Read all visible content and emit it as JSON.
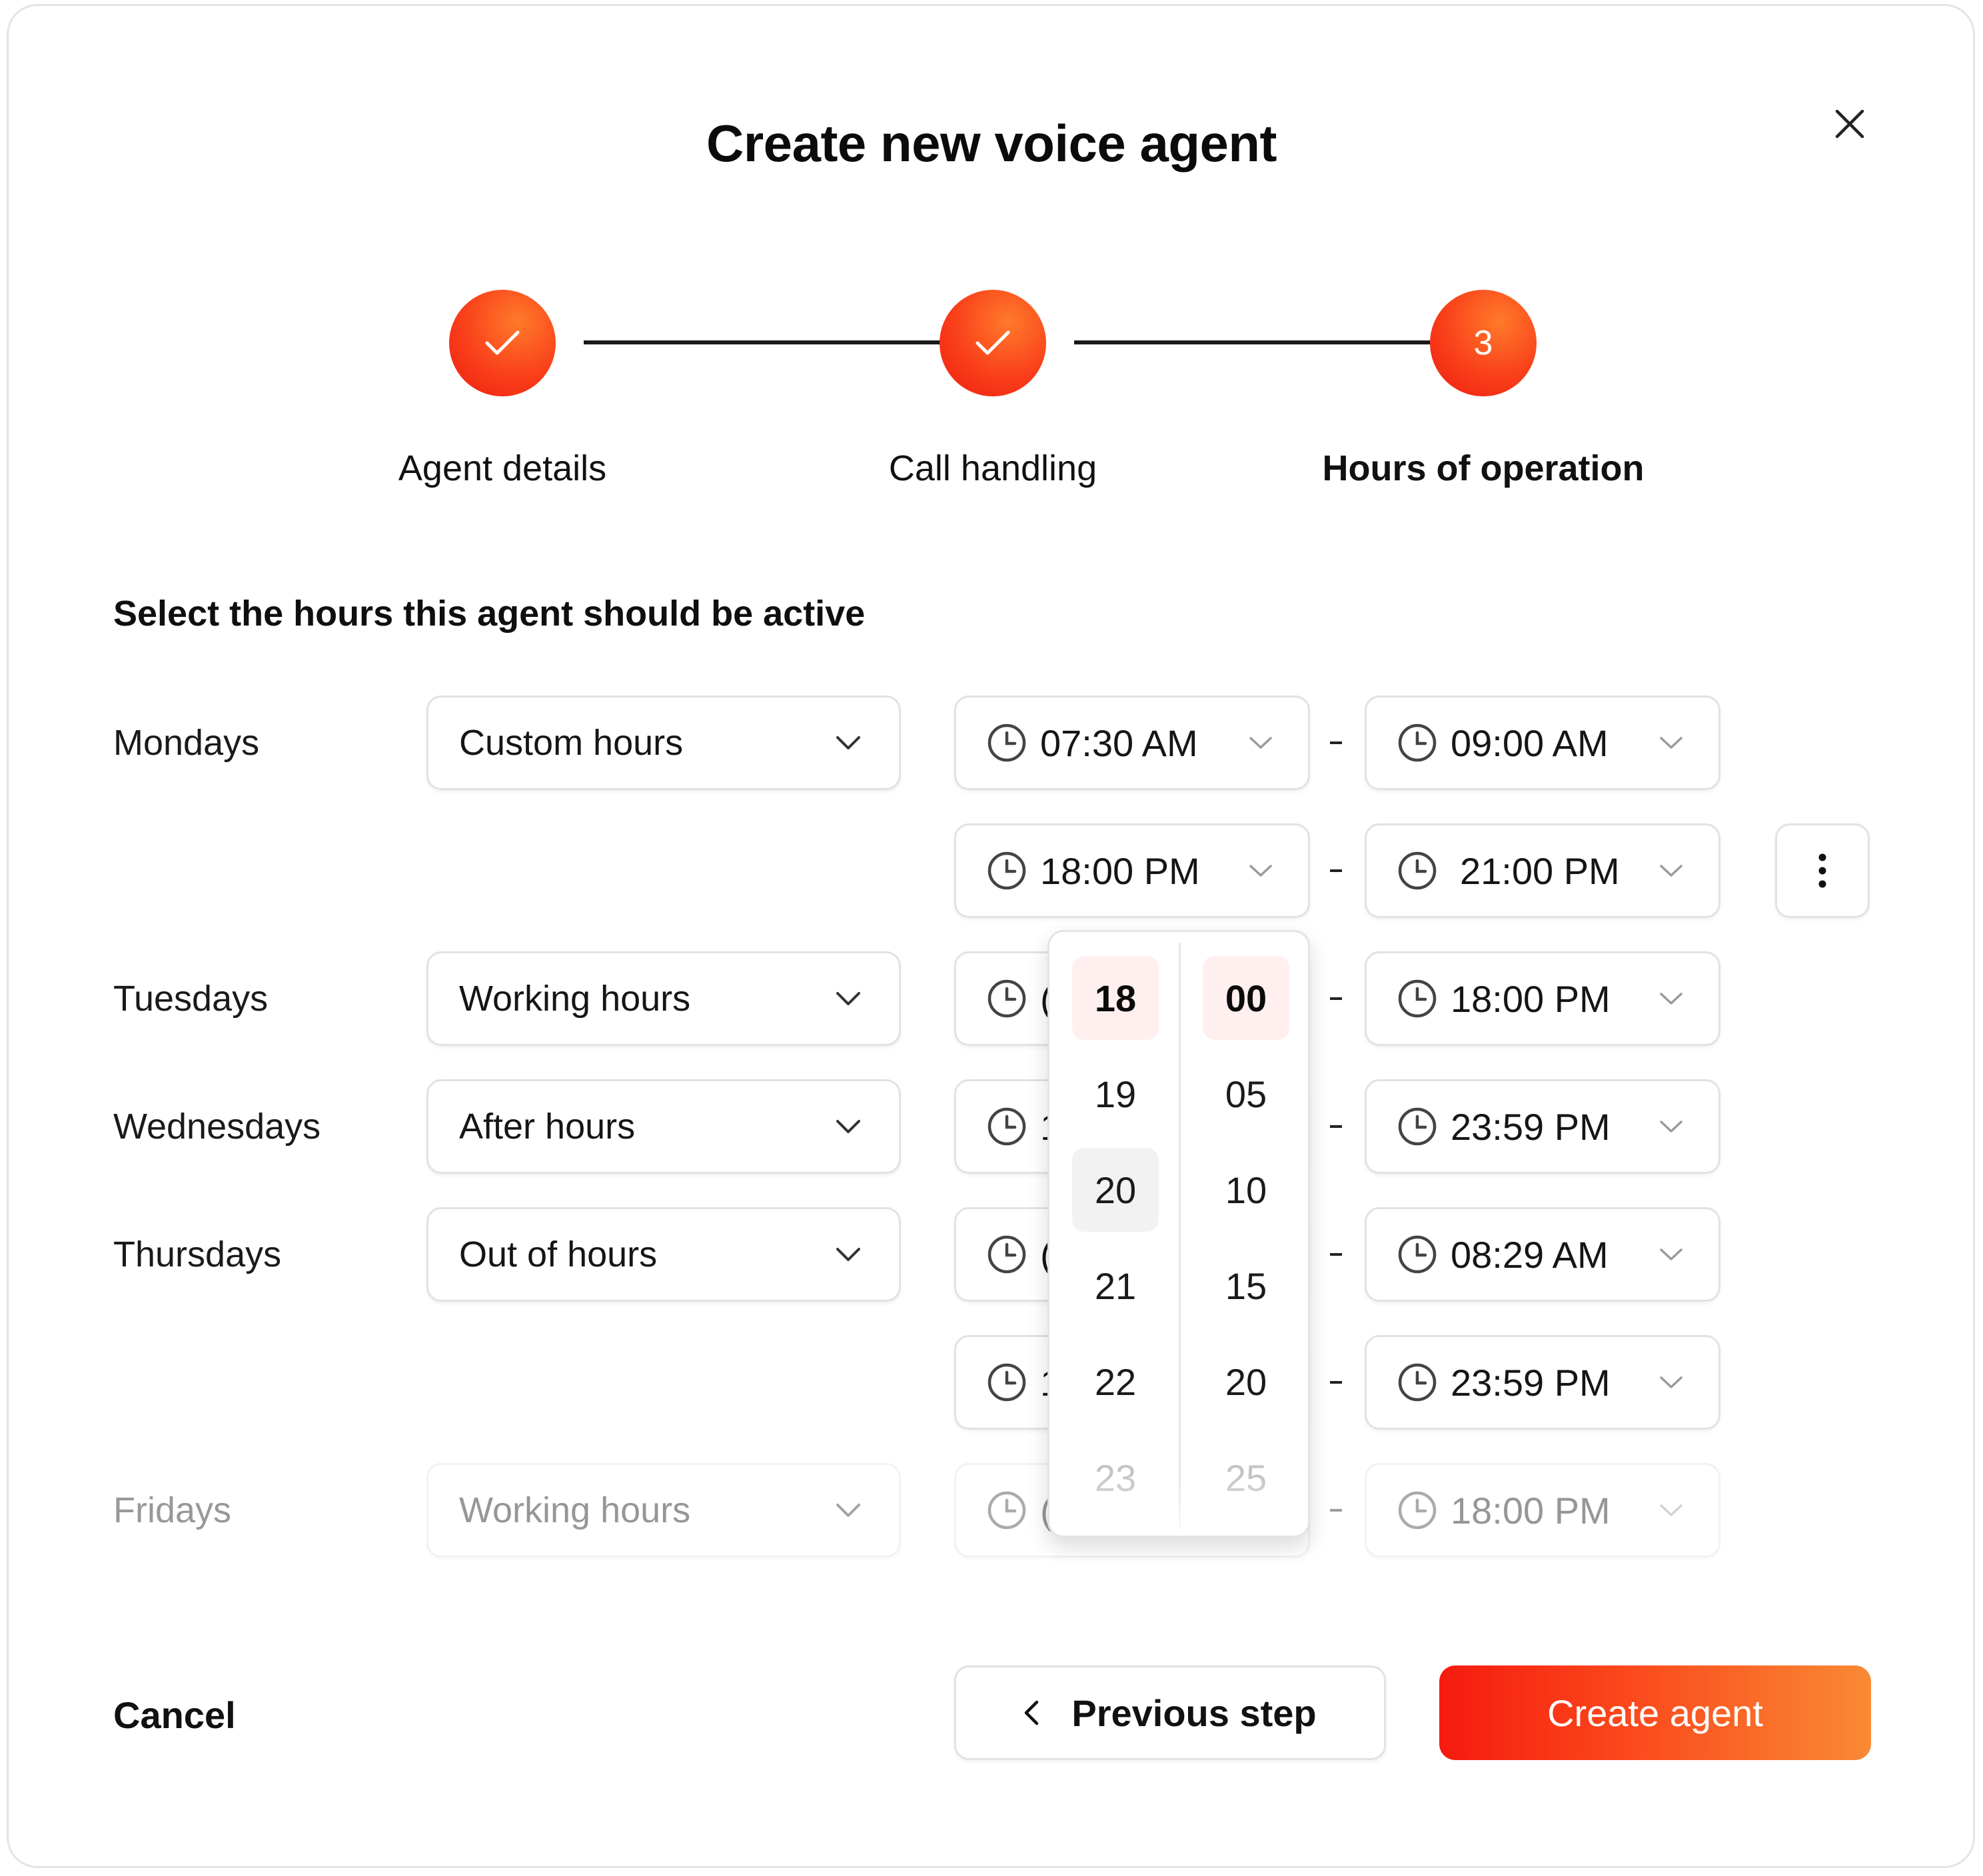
{
  "dialog": {
    "title": "Create new voice agent"
  },
  "stepper": {
    "steps": [
      {
        "label": "Agent details",
        "state": "complete",
        "icon": "check-icon"
      },
      {
        "label": "Call handling",
        "state": "complete",
        "icon": "check-icon"
      },
      {
        "label": "Hours of operation",
        "state": "current",
        "number": "3"
      }
    ],
    "accent": "#f93f1a"
  },
  "section_title": "Select the hours this agent should be active",
  "schedule": {
    "mondays": {
      "label": "Mondays",
      "mode": "Custom hours",
      "slots": [
        {
          "start": "07:30 AM",
          "end": "09:00 AM"
        },
        {
          "start": "18:00 PM",
          "end": "21:00 PM"
        }
      ]
    },
    "tuesdays": {
      "label": "Tuesdays",
      "mode": "Working hours",
      "start": "(",
      "end": "18:00 PM"
    },
    "wednesdays": {
      "label": "Wednesdays",
      "mode": "After hours",
      "start": "1",
      "end": "23:59 PM"
    },
    "thursdays": {
      "label": "Thursdays",
      "mode": "Out of hours",
      "slots": [
        {
          "start": "(",
          "end": "08:29 AM"
        },
        {
          "start": "1",
          "end": "23:59 PM"
        }
      ]
    },
    "fridays": {
      "label": "Fridays",
      "mode": "Working hours",
      "start": "(",
      "end": "18:00 PM"
    }
  },
  "time_picker": {
    "hours": [
      "18",
      "19",
      "20",
      "21",
      "22",
      "23"
    ],
    "minutes": [
      "00",
      "05",
      "10",
      "15",
      "20",
      "25"
    ],
    "selected_hour": "18",
    "selected_minute": "00",
    "hovered_hour": "20"
  },
  "footer": {
    "cancel_label": "Cancel",
    "previous_label": "Previous step",
    "create_label": "Create agent"
  }
}
